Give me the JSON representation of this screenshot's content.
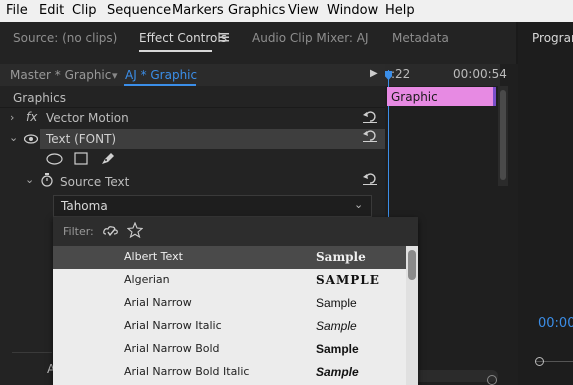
{
  "menu": [
    "File",
    "Edit",
    "Clip",
    "Sequence",
    "Markers",
    "Graphics",
    "View",
    "Window",
    "Help"
  ],
  "panel_tabs": {
    "source": "Source: (no clips)",
    "effect_controls": "Effect Controls",
    "audio_mixer": "Audio Clip Mixer: AJ",
    "metadata": "Metadata",
    "program": "Program"
  },
  "sub_tabs": {
    "master": "Master * Graphic",
    "clip": "AJ * Graphic"
  },
  "timeline": {
    "time_left": ":22",
    "time_right": "00:00:54",
    "clip_label": "Graphic"
  },
  "effects": {
    "section": "Graphics",
    "fx_label": "fx",
    "vector_motion": "Vector Motion",
    "text_layer": "Text (FONT)",
    "source_text": "Source Text"
  },
  "font_select": {
    "value": "Tahoma"
  },
  "dropdown": {
    "filter_label": "Filter:",
    "fonts": [
      {
        "name": "Albert Text",
        "sample": "Sample"
      },
      {
        "name": "Algerian",
        "sample": "SAMPLE"
      },
      {
        "name": "Arial Narrow",
        "sample": "Sample"
      },
      {
        "name": "Arial Narrow Italic",
        "sample": "Sample"
      },
      {
        "name": "Arial Narrow Bold",
        "sample": "Sample"
      },
      {
        "name": "Arial Narrow Bold Italic",
        "sample": "Sample"
      }
    ]
  },
  "program_timecode": "00:00",
  "bottom_left_letter": "A",
  "colors": {
    "accent_blue": "#3b8ee8",
    "clip_pink": "#e78ae3"
  }
}
